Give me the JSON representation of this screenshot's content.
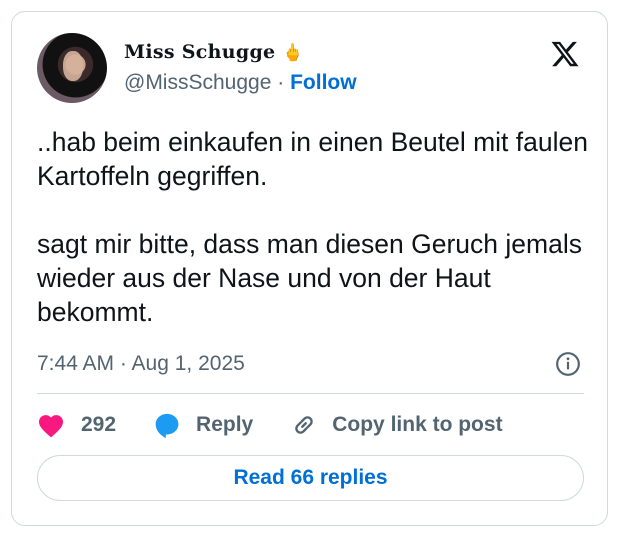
{
  "tweet": {
    "display_name": "Miss Schugge",
    "display_name_emoji": "🖕",
    "handle": "@MissSchugge",
    "separator": "·",
    "follow_label": "Follow",
    "paragraphs": [
      "..hab beim einkaufen in einen Beutel mit faulen Kartoffeln gegriffen.",
      "sagt mir bitte, dass man diesen Geruch jemals wieder aus der Nase und von der Haut bekommt."
    ],
    "timestamp": "7:44 AM · Aug 1, 2025"
  },
  "actions": {
    "like_count": "292",
    "reply_label": "Reply",
    "copy_link_label": "Copy link to post"
  },
  "read_replies_label": "Read 66 replies",
  "colors": {
    "text": "#0f1419",
    "secondary": "#536471",
    "link": "#006fd6",
    "like": "#f91880",
    "reply": "#1d9bf0",
    "border": "#cfd9de"
  },
  "icons": {
    "brand": "x-logo-icon",
    "info": "info-icon",
    "like": "heart-icon",
    "reply": "speech-bubble-icon",
    "copy": "link-icon"
  }
}
